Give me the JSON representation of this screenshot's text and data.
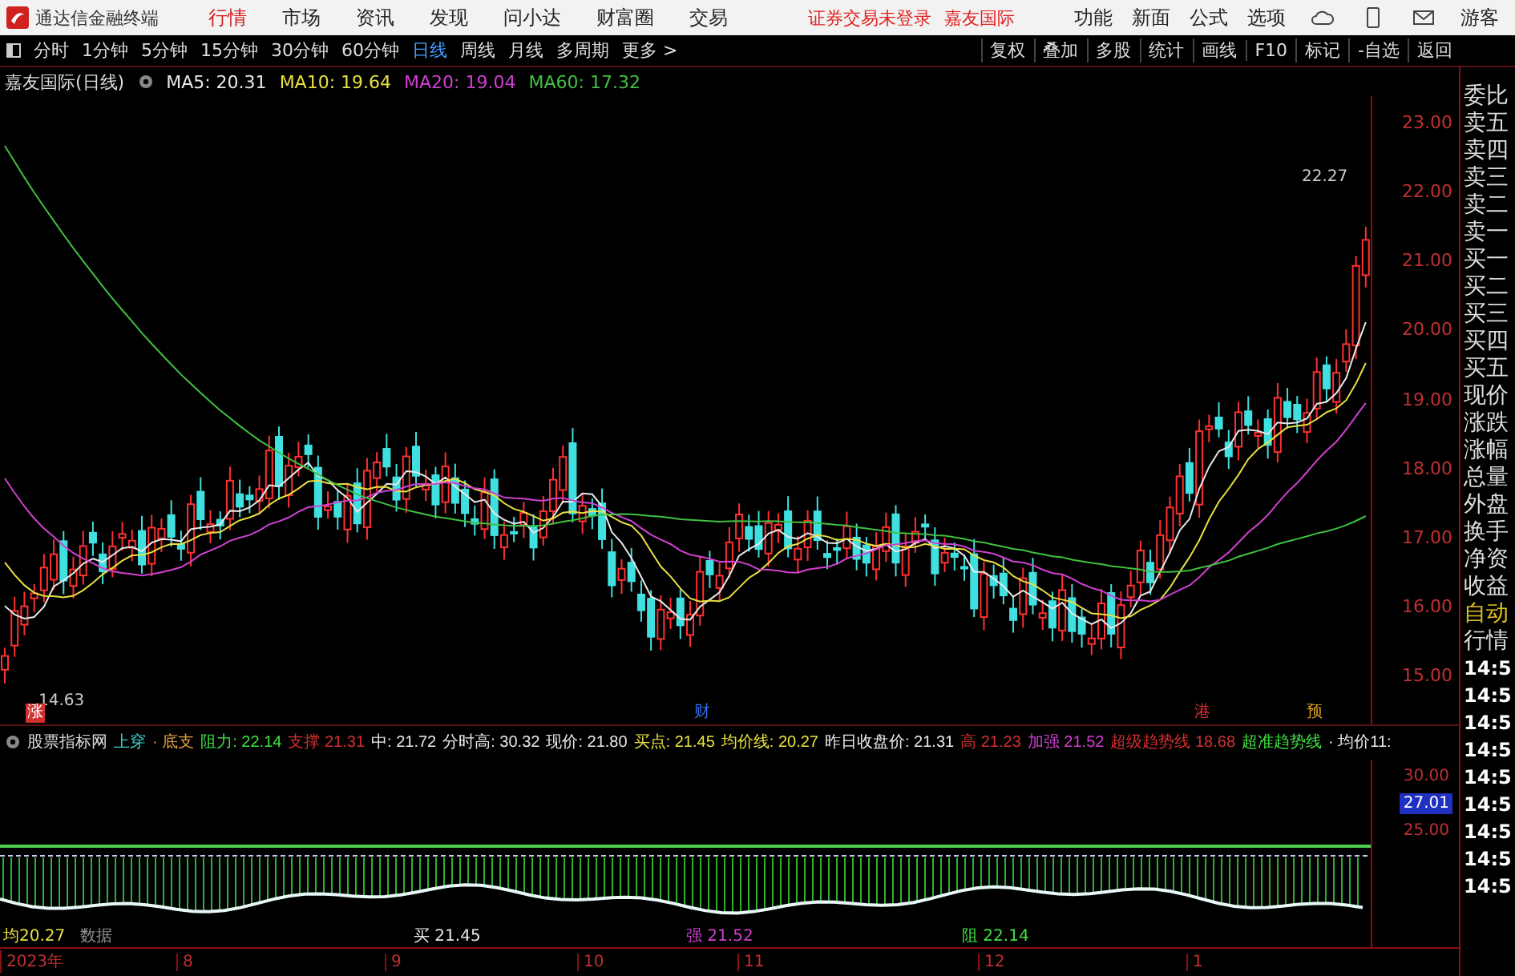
{
  "app_bar": {
    "app_name": "通达信金融终端",
    "menu": [
      {
        "label": "行情",
        "selected": true
      },
      {
        "label": "市场",
        "selected": false
      },
      {
        "label": "资讯",
        "selected": false
      },
      {
        "label": "发现",
        "selected": false
      },
      {
        "label": "问小达",
        "selected": false
      },
      {
        "label": "财富圈",
        "selected": false
      },
      {
        "label": "交易",
        "selected": false
      }
    ],
    "login_status": "证券交易未登录",
    "stock_name": "嘉友国际",
    "tools": [
      "功能",
      "新面",
      "公式",
      "选项"
    ],
    "user": "游客"
  },
  "period_bar": {
    "periods": [
      {
        "label": "分时",
        "selected": false
      },
      {
        "label": "1分钟",
        "selected": false
      },
      {
        "label": "5分钟",
        "selected": false
      },
      {
        "label": "15分钟",
        "selected": false
      },
      {
        "label": "30分钟",
        "selected": false
      },
      {
        "label": "60分钟",
        "selected": false
      },
      {
        "label": "日线",
        "selected": true
      },
      {
        "label": "周线",
        "selected": false
      },
      {
        "label": "月线",
        "selected": false
      },
      {
        "label": "多周期",
        "selected": false
      },
      {
        "label": "更多 >",
        "selected": false
      }
    ],
    "actions": [
      "复权",
      "叠加",
      "多股",
      "统计",
      "画线",
      "F10",
      "标记",
      "-自选",
      "返回"
    ]
  },
  "chart": {
    "title": "嘉友国际(日线)",
    "moving_averages": [
      {
        "label": "MA5: 20.31",
        "color": "#e8e8e8"
      },
      {
        "label": "MA10: 19.64",
        "color": "#e8e040"
      },
      {
        "label": "MA20: 19.04",
        "color": "#d040d0"
      },
      {
        "label": "MA60: 17.32",
        "color": "#40c040"
      }
    ],
    "price_axis": [
      "23.00",
      "22.00",
      "21.00",
      "20.00",
      "19.00",
      "18.00",
      "17.00",
      "16.00",
      "15.00"
    ],
    "high_label": "22.27",
    "low_label": "14.63",
    "event_markers": [
      {
        "label": "涨",
        "color": "#d03030"
      },
      {
        "label": "财",
        "color": "#3070f0"
      },
      {
        "label": "港",
        "color": "#e03030"
      },
      {
        "label": "预",
        "color": "#e0a020"
      }
    ]
  },
  "indicator_bar": {
    "name": "股票指标网",
    "items": [
      {
        "label": "上穿",
        "value": "",
        "color": "#40d0d0"
      },
      {
        "label": "· 底支",
        "value": "",
        "color": "#e0a040"
      },
      {
        "label": "阻力:",
        "value": "22.14",
        "color": "#40e040"
      },
      {
        "label": "支撑",
        "value": "21.31",
        "color": "#d03030"
      },
      {
        "label": "中:",
        "value": "21.72",
        "color": "#e8e8e8"
      },
      {
        "label": "分时高:",
        "value": "30.32",
        "color": "#e8e8e8"
      },
      {
        "label": "现价:",
        "value": "21.80",
        "color": "#e8e8e8"
      },
      {
        "label": "买点:",
        "value": "21.45",
        "color": "#e8e040"
      },
      {
        "label": "均价线:",
        "value": "20.27",
        "color": "#e8e040"
      },
      {
        "label": "昨日收盘价:",
        "value": "21.31",
        "color": "#e8e8e8"
      },
      {
        "label": "高",
        "value": "21.23",
        "color": "#d03030"
      },
      {
        "label": "加强",
        "value": "21.52",
        "color": "#d040d0"
      },
      {
        "label": "超级趋势线",
        "value": "18.68",
        "color": "#d03030"
      },
      {
        "label": "超准趋势线",
        "value": "",
        "color": "#40e040"
      },
      {
        "label": "· 均价11:",
        "value": "",
        "color": "#e8e8e8"
      }
    ]
  },
  "lower_panel": {
    "axis": [
      {
        "text": "30.00",
        "selected": false
      },
      {
        "text": "27.01",
        "selected": true
      },
      {
        "text": "25.00",
        "selected": false
      }
    ],
    "labels": [
      {
        "text": "均20.27",
        "color": "#e8e040"
      },
      {
        "text": "数据",
        "color": "#909090"
      },
      {
        "text": "买 21.45",
        "color": "#e8e8e8"
      },
      {
        "text": "强 21.52",
        "color": "#d040d0"
      },
      {
        "text": "阻 22.14",
        "color": "#40e040"
      }
    ]
  },
  "time_axis": [
    "2023年",
    "8",
    "9",
    "10",
    "11",
    "12",
    "1"
  ],
  "side_panel": {
    "labels": [
      {
        "text": "委比",
        "kind": "quote"
      },
      {
        "text": "卖五",
        "kind": "quote"
      },
      {
        "text": "卖四",
        "kind": "quote"
      },
      {
        "text": "卖三",
        "kind": "quote"
      },
      {
        "text": "卖二",
        "kind": "quote"
      },
      {
        "text": "卖一",
        "kind": "quote"
      },
      {
        "text": "买一",
        "kind": "quote"
      },
      {
        "text": "买二",
        "kind": "quote"
      },
      {
        "text": "买三",
        "kind": "quote"
      },
      {
        "text": "买四",
        "kind": "quote"
      },
      {
        "text": "买五",
        "kind": "quote"
      },
      {
        "text": "现价",
        "kind": "quote"
      },
      {
        "text": "涨跌",
        "kind": "quote"
      },
      {
        "text": "涨幅",
        "kind": "quote"
      },
      {
        "text": "总量",
        "kind": "quote"
      },
      {
        "text": "外盘",
        "kind": "quote"
      },
      {
        "text": "换手",
        "kind": "quote"
      },
      {
        "text": "净资",
        "kind": "quote"
      },
      {
        "text": "收益",
        "kind": "quote"
      },
      {
        "text": "自动",
        "kind": "setting"
      },
      {
        "text": "行情",
        "kind": "quote"
      }
    ],
    "times": [
      "14:5",
      "14:5",
      "14:5",
      "14:5",
      "14:5",
      "14:5",
      "14:5",
      "14:5",
      "14:5"
    ]
  }
}
